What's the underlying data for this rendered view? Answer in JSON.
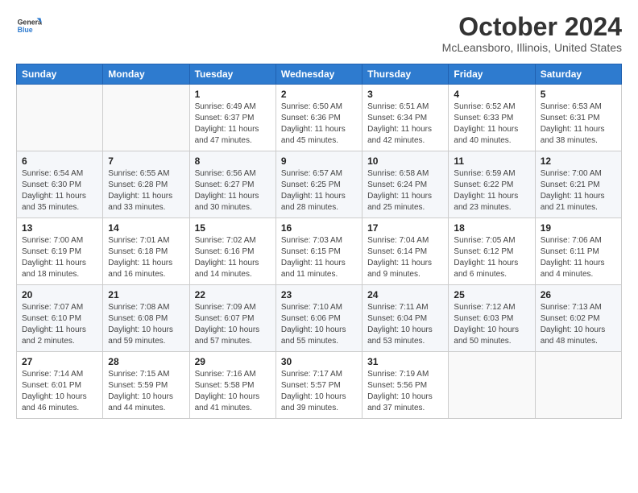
{
  "header": {
    "logo_line1": "General",
    "logo_line2": "Blue",
    "month": "October 2024",
    "location": "McLeansboro, Illinois, United States"
  },
  "weekdays": [
    "Sunday",
    "Monday",
    "Tuesday",
    "Wednesday",
    "Thursday",
    "Friday",
    "Saturday"
  ],
  "weeks": [
    [
      {
        "day": "",
        "sunrise": "",
        "sunset": "",
        "daylight": ""
      },
      {
        "day": "",
        "sunrise": "",
        "sunset": "",
        "daylight": ""
      },
      {
        "day": "1",
        "sunrise": "Sunrise: 6:49 AM",
        "sunset": "Sunset: 6:37 PM",
        "daylight": "Daylight: 11 hours and 47 minutes."
      },
      {
        "day": "2",
        "sunrise": "Sunrise: 6:50 AM",
        "sunset": "Sunset: 6:36 PM",
        "daylight": "Daylight: 11 hours and 45 minutes."
      },
      {
        "day": "3",
        "sunrise": "Sunrise: 6:51 AM",
        "sunset": "Sunset: 6:34 PM",
        "daylight": "Daylight: 11 hours and 42 minutes."
      },
      {
        "day": "4",
        "sunrise": "Sunrise: 6:52 AM",
        "sunset": "Sunset: 6:33 PM",
        "daylight": "Daylight: 11 hours and 40 minutes."
      },
      {
        "day": "5",
        "sunrise": "Sunrise: 6:53 AM",
        "sunset": "Sunset: 6:31 PM",
        "daylight": "Daylight: 11 hours and 38 minutes."
      }
    ],
    [
      {
        "day": "6",
        "sunrise": "Sunrise: 6:54 AM",
        "sunset": "Sunset: 6:30 PM",
        "daylight": "Daylight: 11 hours and 35 minutes."
      },
      {
        "day": "7",
        "sunrise": "Sunrise: 6:55 AM",
        "sunset": "Sunset: 6:28 PM",
        "daylight": "Daylight: 11 hours and 33 minutes."
      },
      {
        "day": "8",
        "sunrise": "Sunrise: 6:56 AM",
        "sunset": "Sunset: 6:27 PM",
        "daylight": "Daylight: 11 hours and 30 minutes."
      },
      {
        "day": "9",
        "sunrise": "Sunrise: 6:57 AM",
        "sunset": "Sunset: 6:25 PM",
        "daylight": "Daylight: 11 hours and 28 minutes."
      },
      {
        "day": "10",
        "sunrise": "Sunrise: 6:58 AM",
        "sunset": "Sunset: 6:24 PM",
        "daylight": "Daylight: 11 hours and 25 minutes."
      },
      {
        "day": "11",
        "sunrise": "Sunrise: 6:59 AM",
        "sunset": "Sunset: 6:22 PM",
        "daylight": "Daylight: 11 hours and 23 minutes."
      },
      {
        "day": "12",
        "sunrise": "Sunrise: 7:00 AM",
        "sunset": "Sunset: 6:21 PM",
        "daylight": "Daylight: 11 hours and 21 minutes."
      }
    ],
    [
      {
        "day": "13",
        "sunrise": "Sunrise: 7:00 AM",
        "sunset": "Sunset: 6:19 PM",
        "daylight": "Daylight: 11 hours and 18 minutes."
      },
      {
        "day": "14",
        "sunrise": "Sunrise: 7:01 AM",
        "sunset": "Sunset: 6:18 PM",
        "daylight": "Daylight: 11 hours and 16 minutes."
      },
      {
        "day": "15",
        "sunrise": "Sunrise: 7:02 AM",
        "sunset": "Sunset: 6:16 PM",
        "daylight": "Daylight: 11 hours and 14 minutes."
      },
      {
        "day": "16",
        "sunrise": "Sunrise: 7:03 AM",
        "sunset": "Sunset: 6:15 PM",
        "daylight": "Daylight: 11 hours and 11 minutes."
      },
      {
        "day": "17",
        "sunrise": "Sunrise: 7:04 AM",
        "sunset": "Sunset: 6:14 PM",
        "daylight": "Daylight: 11 hours and 9 minutes."
      },
      {
        "day": "18",
        "sunrise": "Sunrise: 7:05 AM",
        "sunset": "Sunset: 6:12 PM",
        "daylight": "Daylight: 11 hours and 6 minutes."
      },
      {
        "day": "19",
        "sunrise": "Sunrise: 7:06 AM",
        "sunset": "Sunset: 6:11 PM",
        "daylight": "Daylight: 11 hours and 4 minutes."
      }
    ],
    [
      {
        "day": "20",
        "sunrise": "Sunrise: 7:07 AM",
        "sunset": "Sunset: 6:10 PM",
        "daylight": "Daylight: 11 hours and 2 minutes."
      },
      {
        "day": "21",
        "sunrise": "Sunrise: 7:08 AM",
        "sunset": "Sunset: 6:08 PM",
        "daylight": "Daylight: 10 hours and 59 minutes."
      },
      {
        "day": "22",
        "sunrise": "Sunrise: 7:09 AM",
        "sunset": "Sunset: 6:07 PM",
        "daylight": "Daylight: 10 hours and 57 minutes."
      },
      {
        "day": "23",
        "sunrise": "Sunrise: 7:10 AM",
        "sunset": "Sunset: 6:06 PM",
        "daylight": "Daylight: 10 hours and 55 minutes."
      },
      {
        "day": "24",
        "sunrise": "Sunrise: 7:11 AM",
        "sunset": "Sunset: 6:04 PM",
        "daylight": "Daylight: 10 hours and 53 minutes."
      },
      {
        "day": "25",
        "sunrise": "Sunrise: 7:12 AM",
        "sunset": "Sunset: 6:03 PM",
        "daylight": "Daylight: 10 hours and 50 minutes."
      },
      {
        "day": "26",
        "sunrise": "Sunrise: 7:13 AM",
        "sunset": "Sunset: 6:02 PM",
        "daylight": "Daylight: 10 hours and 48 minutes."
      }
    ],
    [
      {
        "day": "27",
        "sunrise": "Sunrise: 7:14 AM",
        "sunset": "Sunset: 6:01 PM",
        "daylight": "Daylight: 10 hours and 46 minutes."
      },
      {
        "day": "28",
        "sunrise": "Sunrise: 7:15 AM",
        "sunset": "Sunset: 5:59 PM",
        "daylight": "Daylight: 10 hours and 44 minutes."
      },
      {
        "day": "29",
        "sunrise": "Sunrise: 7:16 AM",
        "sunset": "Sunset: 5:58 PM",
        "daylight": "Daylight: 10 hours and 41 minutes."
      },
      {
        "day": "30",
        "sunrise": "Sunrise: 7:17 AM",
        "sunset": "Sunset: 5:57 PM",
        "daylight": "Daylight: 10 hours and 39 minutes."
      },
      {
        "day": "31",
        "sunrise": "Sunrise: 7:19 AM",
        "sunset": "Sunset: 5:56 PM",
        "daylight": "Daylight: 10 hours and 37 minutes."
      },
      {
        "day": "",
        "sunrise": "",
        "sunset": "",
        "daylight": ""
      },
      {
        "day": "",
        "sunrise": "",
        "sunset": "",
        "daylight": ""
      }
    ]
  ]
}
